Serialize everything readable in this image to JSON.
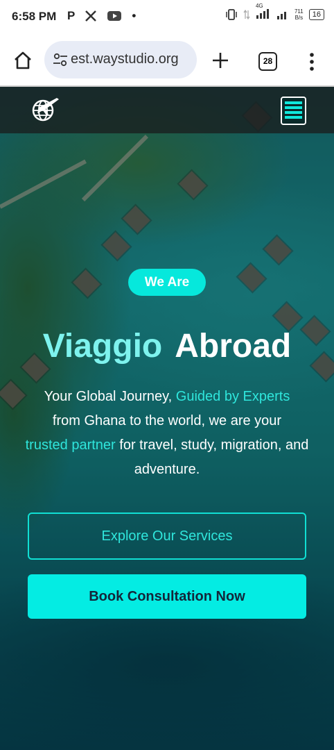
{
  "status_bar": {
    "time": "6:58 PM",
    "notification_icons": [
      "p-app-icon",
      "x-icon",
      "youtube-icon",
      "dot-icon"
    ],
    "p_glyph": "P",
    "dot_glyph": "•",
    "network_type": "4G",
    "net_speed_value": "711",
    "net_speed_unit": "B/s",
    "battery": "16"
  },
  "browser": {
    "url": "est.waystudio.org",
    "tab_count": "28"
  },
  "site": {
    "badge": "We Are",
    "title_word1": "Viaggio",
    "title_word2": "Abroad",
    "desc_part1": "Your Global Journey, ",
    "desc_highlight1": "Guided by Experts",
    "desc_part2": "from Ghana to the world, we are your",
    "desc_highlight2": "trusted partner",
    "desc_part3": " for travel, study, migration, and adventure.",
    "primary_button": "Explore Our Services",
    "secondary_button": "Book Consultation Now"
  },
  "colors": {
    "accent": "#06e8dc",
    "accent_text": "#2fe6dc",
    "title_light": "#7ef3ee",
    "button_text_dark": "#14263a"
  }
}
